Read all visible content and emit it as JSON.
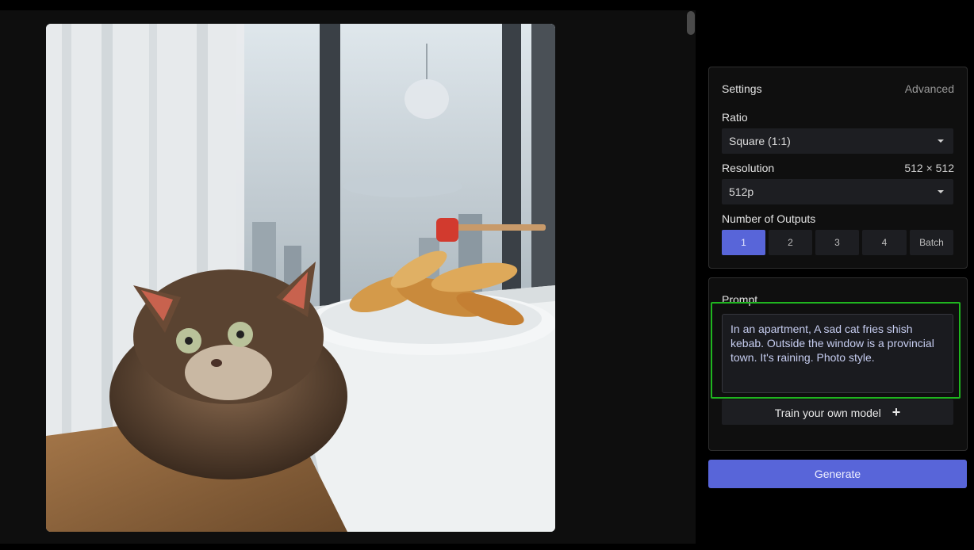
{
  "settings": {
    "title": "Settings",
    "advanced_label": "Advanced",
    "ratio_label": "Ratio",
    "ratio_value": "Square (1:1)",
    "resolution_label": "Resolution",
    "resolution_dims": "512 × 512",
    "resolution_value": "512p",
    "outputs_label": "Number of Outputs",
    "outputs_options": [
      "1",
      "2",
      "3",
      "4",
      "Batch"
    ],
    "outputs_selected": "1"
  },
  "prompt": {
    "label": "Prompt",
    "value": "In an apartment, A sad cat fries shish kebab. Outside the window is a provincial town. It's raining. Photo style."
  },
  "train_button_label": "Train your own model",
  "generate_button_label": "Generate",
  "colors": {
    "accent": "#5865d9",
    "highlight": "#1fb51f",
    "panel_bg": "#0f0f0f"
  },
  "icons": {
    "train_button": "plus-icon",
    "dropdown": "caret-down-icon"
  }
}
